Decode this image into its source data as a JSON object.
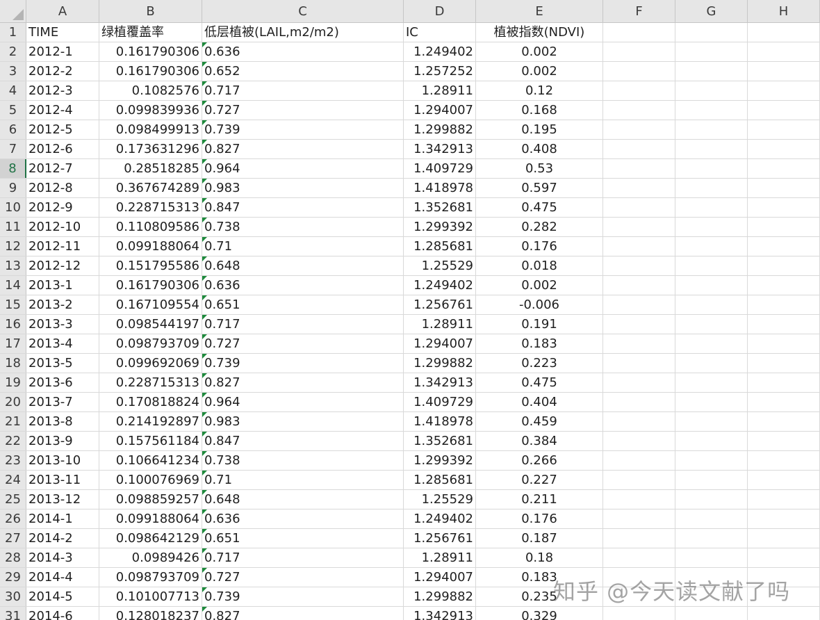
{
  "columns": [
    "A",
    "B",
    "C",
    "D",
    "E",
    "F",
    "G",
    "H"
  ],
  "active_row": "8",
  "rows": [
    {
      "n": "1",
      "A": "TIME",
      "B": "绿植覆盖率",
      "C": "低层植被(LAIL,m2/m2)",
      "D": "IC",
      "E": "植被指数(NDVI)"
    },
    {
      "n": "2",
      "A": "2012-1",
      "B": "0.161790306",
      "C": "0.636",
      "D": "1.249402",
      "E": "0.002"
    },
    {
      "n": "3",
      "A": "2012-2",
      "B": "0.161790306",
      "C": "0.652",
      "D": "1.257252",
      "E": "0.002"
    },
    {
      "n": "4",
      "A": "2012-3",
      "B": "0.1082576",
      "C": "0.717",
      "D": "1.28911",
      "E": "0.12"
    },
    {
      "n": "5",
      "A": "2012-4",
      "B": "0.099839936",
      "C": "0.727",
      "D": "1.294007",
      "E": "0.168"
    },
    {
      "n": "6",
      "A": "2012-5",
      "B": "0.098499913",
      "C": "0.739",
      "D": "1.299882",
      "E": "0.195"
    },
    {
      "n": "7",
      "A": "2012-6",
      "B": "0.173631296",
      "C": "0.827",
      "D": "1.342913",
      "E": "0.408"
    },
    {
      "n": "8",
      "A": "2012-7",
      "B": "0.28518285",
      "C": "0.964",
      "D": "1.409729",
      "E": "0.53"
    },
    {
      "n": "9",
      "A": "2012-8",
      "B": "0.367674289",
      "C": "0.983",
      "D": "1.418978",
      "E": "0.597"
    },
    {
      "n": "10",
      "A": "2012-9",
      "B": "0.228715313",
      "C": "0.847",
      "D": "1.352681",
      "E": "0.475"
    },
    {
      "n": "11",
      "A": "2012-10",
      "B": "0.110809586",
      "C": "0.738",
      "D": "1.299392",
      "E": "0.282"
    },
    {
      "n": "12",
      "A": "2012-11",
      "B": "0.099188064",
      "C": "0.71",
      "D": "1.285681",
      "E": "0.176"
    },
    {
      "n": "13",
      "A": "2012-12",
      "B": "0.151795586",
      "C": "0.648",
      "D": "1.25529",
      "E": "0.018"
    },
    {
      "n": "14",
      "A": "2013-1",
      "B": "0.161790306",
      "C": "0.636",
      "D": "1.249402",
      "E": "0.002"
    },
    {
      "n": "15",
      "A": "2013-2",
      "B": "0.167109554",
      "C": "0.651",
      "D": "1.256761",
      "E": "-0.006"
    },
    {
      "n": "16",
      "A": "2013-3",
      "B": "0.098544197",
      "C": "0.717",
      "D": "1.28911",
      "E": "0.191"
    },
    {
      "n": "17",
      "A": "2013-4",
      "B": "0.098793709",
      "C": "0.727",
      "D": "1.294007",
      "E": "0.183"
    },
    {
      "n": "18",
      "A": "2013-5",
      "B": "0.099692069",
      "C": "0.739",
      "D": "1.299882",
      "E": "0.223"
    },
    {
      "n": "19",
      "A": "2013-6",
      "B": "0.228715313",
      "C": "0.827",
      "D": "1.342913",
      "E": "0.475"
    },
    {
      "n": "20",
      "A": "2013-7",
      "B": "0.170818824",
      "C": "0.964",
      "D": "1.409729",
      "E": "0.404"
    },
    {
      "n": "21",
      "A": "2013-8",
      "B": "0.214192897",
      "C": "0.983",
      "D": "1.418978",
      "E": "0.459"
    },
    {
      "n": "22",
      "A": "2013-9",
      "B": "0.157561184",
      "C": "0.847",
      "D": "1.352681",
      "E": "0.384"
    },
    {
      "n": "23",
      "A": "2013-10",
      "B": "0.106641234",
      "C": "0.738",
      "D": "1.299392",
      "E": "0.266"
    },
    {
      "n": "24",
      "A": "2013-11",
      "B": "0.100076969",
      "C": "0.71",
      "D": "1.285681",
      "E": "0.227"
    },
    {
      "n": "25",
      "A": "2013-12",
      "B": "0.098859257",
      "C": "0.648",
      "D": "1.25529",
      "E": "0.211"
    },
    {
      "n": "26",
      "A": "2014-1",
      "B": "0.099188064",
      "C": "0.636",
      "D": "1.249402",
      "E": "0.176"
    },
    {
      "n": "27",
      "A": "2014-2",
      "B": "0.098642129",
      "C": "0.651",
      "D": "1.256761",
      "E": "0.187"
    },
    {
      "n": "28",
      "A": "2014-3",
      "B": "0.0989426",
      "C": "0.717",
      "D": "1.28911",
      "E": "0.18"
    },
    {
      "n": "29",
      "A": "2014-4",
      "B": "0.098793709",
      "C": "0.727",
      "D": "1.294007",
      "E": "0.183"
    },
    {
      "n": "30",
      "A": "2014-5",
      "B": "0.101007713",
      "C": "0.739",
      "D": "1.299882",
      "E": "0.235"
    },
    {
      "n": "31",
      "A": "2014-6",
      "B": "0.128018237",
      "C": "0.827",
      "D": "1.342913",
      "E": "0.329"
    }
  ],
  "watermark": "知乎 @今天读文献了吗",
  "colors": {
    "header_bg": "#e6e6e6",
    "gridline": "#d9d9d9",
    "active_accent": "#217346",
    "number_flag": "#1e8a3c"
  }
}
